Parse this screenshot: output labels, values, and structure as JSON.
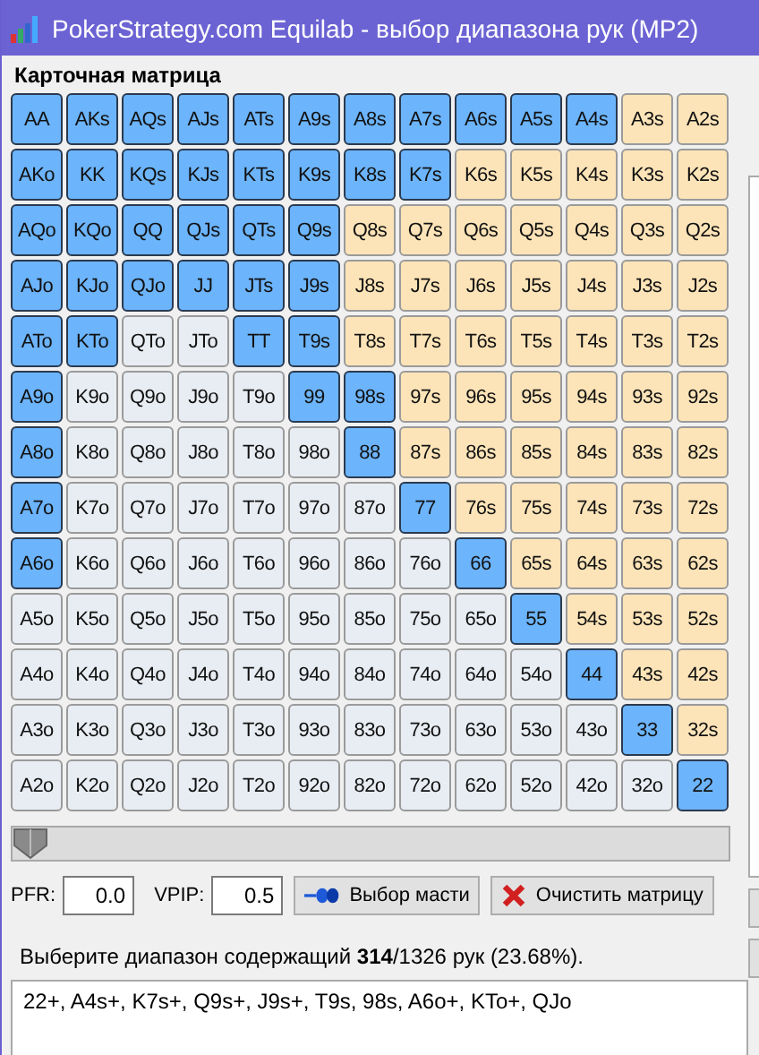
{
  "window": {
    "title": "PokerStrategy.com Equilab - выбор диапазона рук (MP2)"
  },
  "matrix": {
    "title": "Карточная матрица",
    "rows": [
      {
        "cells": [
          {
            "label": "AA",
            "selected": true
          },
          {
            "label": "AKs",
            "selected": true
          },
          {
            "label": "AQs",
            "selected": true
          },
          {
            "label": "AJs",
            "selected": true
          },
          {
            "label": "ATs",
            "selected": true
          },
          {
            "label": "A9s",
            "selected": true
          },
          {
            "label": "A8s",
            "selected": true
          },
          {
            "label": "A7s",
            "selected": true
          },
          {
            "label": "A6s",
            "selected": true
          },
          {
            "label": "A5s",
            "selected": true
          },
          {
            "label": "A4s",
            "selected": true
          },
          {
            "label": "A3s",
            "selected": false
          },
          {
            "label": "A2s",
            "selected": false
          }
        ]
      },
      {
        "cells": [
          {
            "label": "AKo",
            "selected": true
          },
          {
            "label": "KK",
            "selected": true
          },
          {
            "label": "KQs",
            "selected": true
          },
          {
            "label": "KJs",
            "selected": true
          },
          {
            "label": "KTs",
            "selected": true
          },
          {
            "label": "K9s",
            "selected": true
          },
          {
            "label": "K8s",
            "selected": true
          },
          {
            "label": "K7s",
            "selected": true
          },
          {
            "label": "K6s",
            "selected": false
          },
          {
            "label": "K5s",
            "selected": false
          },
          {
            "label": "K4s",
            "selected": false
          },
          {
            "label": "K3s",
            "selected": false
          },
          {
            "label": "K2s",
            "selected": false
          }
        ]
      },
      {
        "cells": [
          {
            "label": "AQo",
            "selected": true
          },
          {
            "label": "KQo",
            "selected": true
          },
          {
            "label": "QQ",
            "selected": true
          },
          {
            "label": "QJs",
            "selected": true
          },
          {
            "label": "QTs",
            "selected": true
          },
          {
            "label": "Q9s",
            "selected": true
          },
          {
            "label": "Q8s",
            "selected": false
          },
          {
            "label": "Q7s",
            "selected": false
          },
          {
            "label": "Q6s",
            "selected": false
          },
          {
            "label": "Q5s",
            "selected": false
          },
          {
            "label": "Q4s",
            "selected": false
          },
          {
            "label": "Q3s",
            "selected": false
          },
          {
            "label": "Q2s",
            "selected": false
          }
        ]
      },
      {
        "cells": [
          {
            "label": "AJo",
            "selected": true
          },
          {
            "label": "KJo",
            "selected": true
          },
          {
            "label": "QJo",
            "selected": true
          },
          {
            "label": "JJ",
            "selected": true
          },
          {
            "label": "JTs",
            "selected": true
          },
          {
            "label": "J9s",
            "selected": true
          },
          {
            "label": "J8s",
            "selected": false
          },
          {
            "label": "J7s",
            "selected": false
          },
          {
            "label": "J6s",
            "selected": false
          },
          {
            "label": "J5s",
            "selected": false
          },
          {
            "label": "J4s",
            "selected": false
          },
          {
            "label": "J3s",
            "selected": false
          },
          {
            "label": "J2s",
            "selected": false
          }
        ]
      },
      {
        "cells": [
          {
            "label": "ATo",
            "selected": true
          },
          {
            "label": "KTo",
            "selected": true
          },
          {
            "label": "QTo",
            "selected": false
          },
          {
            "label": "JTo",
            "selected": false
          },
          {
            "label": "TT",
            "selected": true
          },
          {
            "label": "T9s",
            "selected": true
          },
          {
            "label": "T8s",
            "selected": false
          },
          {
            "label": "T7s",
            "selected": false
          },
          {
            "label": "T6s",
            "selected": false
          },
          {
            "label": "T5s",
            "selected": false
          },
          {
            "label": "T4s",
            "selected": false
          },
          {
            "label": "T3s",
            "selected": false
          },
          {
            "label": "T2s",
            "selected": false
          }
        ]
      },
      {
        "cells": [
          {
            "label": "A9o",
            "selected": true
          },
          {
            "label": "K9o",
            "selected": false
          },
          {
            "label": "Q9o",
            "selected": false
          },
          {
            "label": "J9o",
            "selected": false
          },
          {
            "label": "T9o",
            "selected": false
          },
          {
            "label": "99",
            "selected": true
          },
          {
            "label": "98s",
            "selected": true
          },
          {
            "label": "97s",
            "selected": false
          },
          {
            "label": "96s",
            "selected": false
          },
          {
            "label": "95s",
            "selected": false
          },
          {
            "label": "94s",
            "selected": false
          },
          {
            "label": "93s",
            "selected": false
          },
          {
            "label": "92s",
            "selected": false
          }
        ]
      },
      {
        "cells": [
          {
            "label": "A8o",
            "selected": true
          },
          {
            "label": "K8o",
            "selected": false
          },
          {
            "label": "Q8o",
            "selected": false
          },
          {
            "label": "J8o",
            "selected": false
          },
          {
            "label": "T8o",
            "selected": false
          },
          {
            "label": "98o",
            "selected": false
          },
          {
            "label": "88",
            "selected": true
          },
          {
            "label": "87s",
            "selected": false
          },
          {
            "label": "86s",
            "selected": false
          },
          {
            "label": "85s",
            "selected": false
          },
          {
            "label": "84s",
            "selected": false
          },
          {
            "label": "83s",
            "selected": false
          },
          {
            "label": "82s",
            "selected": false
          }
        ]
      },
      {
        "cells": [
          {
            "label": "A7o",
            "selected": true
          },
          {
            "label": "K7o",
            "selected": false
          },
          {
            "label": "Q7o",
            "selected": false
          },
          {
            "label": "J7o",
            "selected": false
          },
          {
            "label": "T7o",
            "selected": false
          },
          {
            "label": "97o",
            "selected": false
          },
          {
            "label": "87o",
            "selected": false
          },
          {
            "label": "77",
            "selected": true
          },
          {
            "label": "76s",
            "selected": false
          },
          {
            "label": "75s",
            "selected": false
          },
          {
            "label": "74s",
            "selected": false
          },
          {
            "label": "73s",
            "selected": false
          },
          {
            "label": "72s",
            "selected": false
          }
        ]
      },
      {
        "cells": [
          {
            "label": "A6o",
            "selected": true
          },
          {
            "label": "K6o",
            "selected": false
          },
          {
            "label": "Q6o",
            "selected": false
          },
          {
            "label": "J6o",
            "selected": false
          },
          {
            "label": "T6o",
            "selected": false
          },
          {
            "label": "96o",
            "selected": false
          },
          {
            "label": "86o",
            "selected": false
          },
          {
            "label": "76o",
            "selected": false
          },
          {
            "label": "66",
            "selected": true
          },
          {
            "label": "65s",
            "selected": false
          },
          {
            "label": "64s",
            "selected": false
          },
          {
            "label": "63s",
            "selected": false
          },
          {
            "label": "62s",
            "selected": false
          }
        ]
      },
      {
        "cells": [
          {
            "label": "A5o",
            "selected": false
          },
          {
            "label": "K5o",
            "selected": false
          },
          {
            "label": "Q5o",
            "selected": false
          },
          {
            "label": "J5o",
            "selected": false
          },
          {
            "label": "T5o",
            "selected": false
          },
          {
            "label": "95o",
            "selected": false
          },
          {
            "label": "85o",
            "selected": false
          },
          {
            "label": "75o",
            "selected": false
          },
          {
            "label": "65o",
            "selected": false
          },
          {
            "label": "55",
            "selected": true
          },
          {
            "label": "54s",
            "selected": false
          },
          {
            "label": "53s",
            "selected": false
          },
          {
            "label": "52s",
            "selected": false
          }
        ]
      },
      {
        "cells": [
          {
            "label": "A4o",
            "selected": false
          },
          {
            "label": "K4o",
            "selected": false
          },
          {
            "label": "Q4o",
            "selected": false
          },
          {
            "label": "J4o",
            "selected": false
          },
          {
            "label": "T4o",
            "selected": false
          },
          {
            "label": "94o",
            "selected": false
          },
          {
            "label": "84o",
            "selected": false
          },
          {
            "label": "74o",
            "selected": false
          },
          {
            "label": "64o",
            "selected": false
          },
          {
            "label": "54o",
            "selected": false
          },
          {
            "label": "44",
            "selected": true
          },
          {
            "label": "43s",
            "selected": false
          },
          {
            "label": "42s",
            "selected": false
          }
        ]
      },
      {
        "cells": [
          {
            "label": "A3o",
            "selected": false
          },
          {
            "label": "K3o",
            "selected": false
          },
          {
            "label": "Q3o",
            "selected": false
          },
          {
            "label": "J3o",
            "selected": false
          },
          {
            "label": "T3o",
            "selected": false
          },
          {
            "label": "93o",
            "selected": false
          },
          {
            "label": "83o",
            "selected": false
          },
          {
            "label": "73o",
            "selected": false
          },
          {
            "label": "63o",
            "selected": false
          },
          {
            "label": "53o",
            "selected": false
          },
          {
            "label": "43o",
            "selected": false
          },
          {
            "label": "33",
            "selected": true
          },
          {
            "label": "32s",
            "selected": false
          }
        ]
      },
      {
        "cells": [
          {
            "label": "A2o",
            "selected": false
          },
          {
            "label": "K2o",
            "selected": false
          },
          {
            "label": "Q2o",
            "selected": false
          },
          {
            "label": "J2o",
            "selected": false
          },
          {
            "label": "T2o",
            "selected": false
          },
          {
            "label": "92o",
            "selected": false
          },
          {
            "label": "82o",
            "selected": false
          },
          {
            "label": "72o",
            "selected": false
          },
          {
            "label": "62o",
            "selected": false
          },
          {
            "label": "52o",
            "selected": false
          },
          {
            "label": "42o",
            "selected": false
          },
          {
            "label": "32o",
            "selected": false
          },
          {
            "label": "22",
            "selected": true
          }
        ]
      }
    ]
  },
  "slider": {
    "level": 0
  },
  "pfr": {
    "label": "PFR:",
    "value": "0.0"
  },
  "vpip": {
    "label": "VPIP:",
    "value": "0.5"
  },
  "buttons": [
    {
      "label": "Выбор масти",
      "kind": "suits"
    },
    {
      "label": "Очистить матрицу",
      "kind": "clear"
    }
  ],
  "summary": "Выберите диапазон содержащий **314**/1326 рук (23.68%).",
  "range_text": "22+, A4s+, K7s+, Q9s+, J9s+, T9s, 98s, A6o+, KTo+, QJo"
}
